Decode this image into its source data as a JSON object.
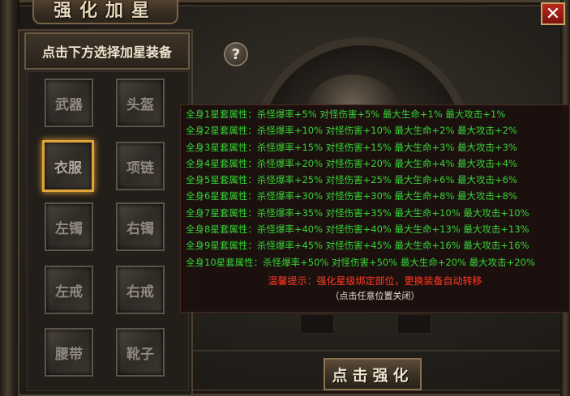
{
  "window": {
    "title": "强化加星",
    "close_label": "✕"
  },
  "left_panel": {
    "header": "点击下方选择加星装备",
    "slots": [
      {
        "label": "武器",
        "selected": false
      },
      {
        "label": "头盔",
        "selected": false
      },
      {
        "label": "衣服",
        "selected": true
      },
      {
        "label": "项链",
        "selected": false
      },
      {
        "label": "左镯",
        "selected": false
      },
      {
        "label": "右镯",
        "selected": false
      },
      {
        "label": "左戒",
        "selected": false
      },
      {
        "label": "右戒",
        "selected": false
      },
      {
        "label": "腰带",
        "selected": false
      },
      {
        "label": "靴子",
        "selected": false
      }
    ]
  },
  "help_icon": "question-mark-icon",
  "help_label": "?",
  "action_button": "点击强化",
  "tooltip": {
    "lines": [
      "全身1星套属性：杀怪爆率+5% 对怪伤害+5% 最大生命+1% 最大攻击+1%",
      "全身2星套属性：杀怪爆率+10% 对怪伤害+10% 最大生命+2% 最大攻击+2%",
      "全身3星套属性：杀怪爆率+15% 对怪伤害+15% 最大生命+3% 最大攻击+3%",
      "全身4星套属性：杀怪爆率+20% 对怪伤害+20% 最大生命+4% 最大攻击+4%",
      "全身5星套属性：杀怪爆率+25% 对怪伤害+25% 最大生命+6% 最大攻击+6%",
      "全身6星套属性：杀怪爆率+30% 对怪伤害+30% 最大生命+8% 最大攻击+8%",
      "全身7星套属性：杀怪爆率+35% 对怪伤害+35% 最大生命+10% 最大攻击+10%",
      "全身8星套属性：杀怪爆率+40% 对怪伤害+40% 最大生命+13% 最大攻击+13%",
      "全身9星套属性：杀怪爆率+45% 对怪伤害+45% 最大生命+16% 最大攻击+16%",
      "全身10星套属性：杀怪爆率+50% 对怪伤害+50% 最大生命+20% 最大攻击+20%"
    ],
    "warning": "温馨提示：强化星级绑定部位，更换装备自动转移",
    "close_hint": "（点击任意位置关闭）"
  },
  "colors": {
    "tooltip_text": "#36d336",
    "warning_text": "#ff3b22",
    "selected_border": "#e0a43a",
    "close_button": "#b8271c"
  }
}
